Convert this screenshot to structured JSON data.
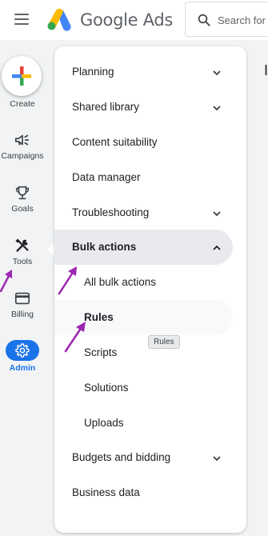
{
  "header": {
    "app_name": "Google Ads",
    "search_placeholder": "Search for"
  },
  "rail": {
    "create": "Create",
    "campaigns": "Campaigns",
    "goals": "Goals",
    "tools": "Tools",
    "billing": "Billing",
    "admin": "Admin"
  },
  "menu": {
    "planning": "Planning",
    "shared_library": "Shared library",
    "content_suitability": "Content suitability",
    "data_manager": "Data manager",
    "troubleshooting": "Troubleshooting",
    "bulk_actions": "Bulk actions",
    "all_bulk_actions": "All bulk actions",
    "rules": "Rules",
    "scripts": "Scripts",
    "solutions": "Solutions",
    "uploads": "Uploads",
    "budgets_and_bidding": "Budgets and bidding",
    "business_data": "Business data"
  },
  "tooltip": "Rules",
  "page_heading_fragment": "I",
  "colors": {
    "accent": "#1a73e8",
    "annotation_arrow": "#9c27b0",
    "active_row": "#e8eaed"
  }
}
